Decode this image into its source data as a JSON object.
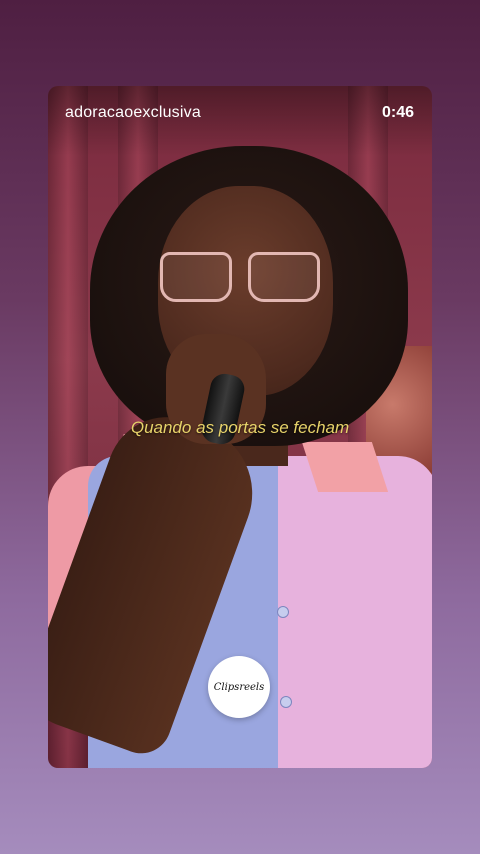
{
  "story": {
    "username": "adoracaoexclusiva",
    "time": "0:46",
    "caption": "Quando as portas se fecham",
    "watermark_text": "Clipsreels"
  },
  "colors": {
    "caption": "#e7d36a",
    "page_top": "#4f1f42",
    "page_bottom": "#a58cbd"
  }
}
